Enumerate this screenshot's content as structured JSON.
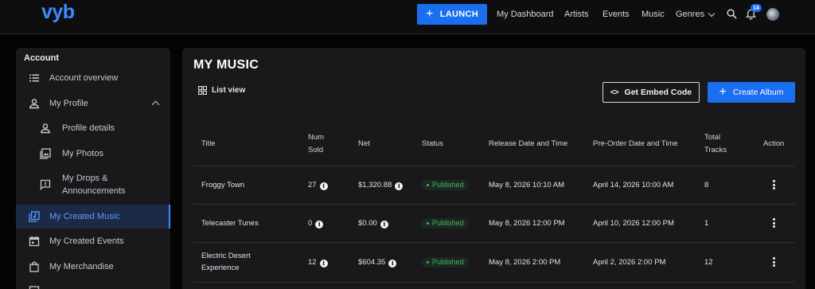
{
  "header": {
    "logo": "vyb",
    "launch_label": "LAUNCH",
    "nav": [
      "My Dashboard",
      "Artists",
      "Events",
      "Music"
    ],
    "genres_label": "Genres",
    "notification_count": "14"
  },
  "sidebar": {
    "heading": "Account",
    "items": [
      {
        "label": "Account overview",
        "icon": "list-icon"
      },
      {
        "label": "My Profile",
        "icon": "person-icon"
      },
      {
        "label": "Profile details",
        "icon": "person-icon"
      },
      {
        "label": "My Photos",
        "icon": "photo-icon"
      },
      {
        "label": "My Drops & Announcements",
        "icon": "announcement-icon"
      },
      {
        "label": "My Created Music",
        "icon": "music-library-icon",
        "active": true
      },
      {
        "label": "My Created Events",
        "icon": "calendar-icon"
      },
      {
        "label": "My Merchandise",
        "icon": "shopping-bag-icon"
      }
    ]
  },
  "main": {
    "title": "MY MUSIC",
    "list_view_label": "List view",
    "embed_label": "Get Embed Code",
    "create_label": "Create Album",
    "columns": {
      "title": "Title",
      "num_sold_1": "Num",
      "num_sold_2": "Sold",
      "net": "Net",
      "status": "Status",
      "release": "Release Date and Time",
      "preorder": "Pre-Order Date and Time",
      "tracks_1": "Total",
      "tracks_2": "Tracks",
      "action": "Action"
    },
    "rows": [
      {
        "title_1": "Froggy Town",
        "title_2": "",
        "sold": "27",
        "net": "$1,320.88",
        "status": "Published",
        "release": "May 8, 2026 10:10 AM",
        "preorder": "April 14, 2026 10:00 AM",
        "tracks": "8"
      },
      {
        "title_1": "Telecaster Tunes",
        "title_2": "",
        "sold": "0",
        "net": "$0.00",
        "status": "Published",
        "release": "May 8, 2026 12:00 PM",
        "preorder": "April 10, 2026 12:00 PM",
        "tracks": "1"
      },
      {
        "title_1": "Electric Desert",
        "title_2": "Experience",
        "sold": "12",
        "net": "$604.35",
        "status": "Published",
        "release": "May 8, 2026 2:00 PM",
        "preorder": "April 2, 2026 2:00 PM",
        "tracks": "12"
      }
    ]
  },
  "colors": {
    "accent": "#1a6ef0",
    "published": "#4caf6b"
  }
}
